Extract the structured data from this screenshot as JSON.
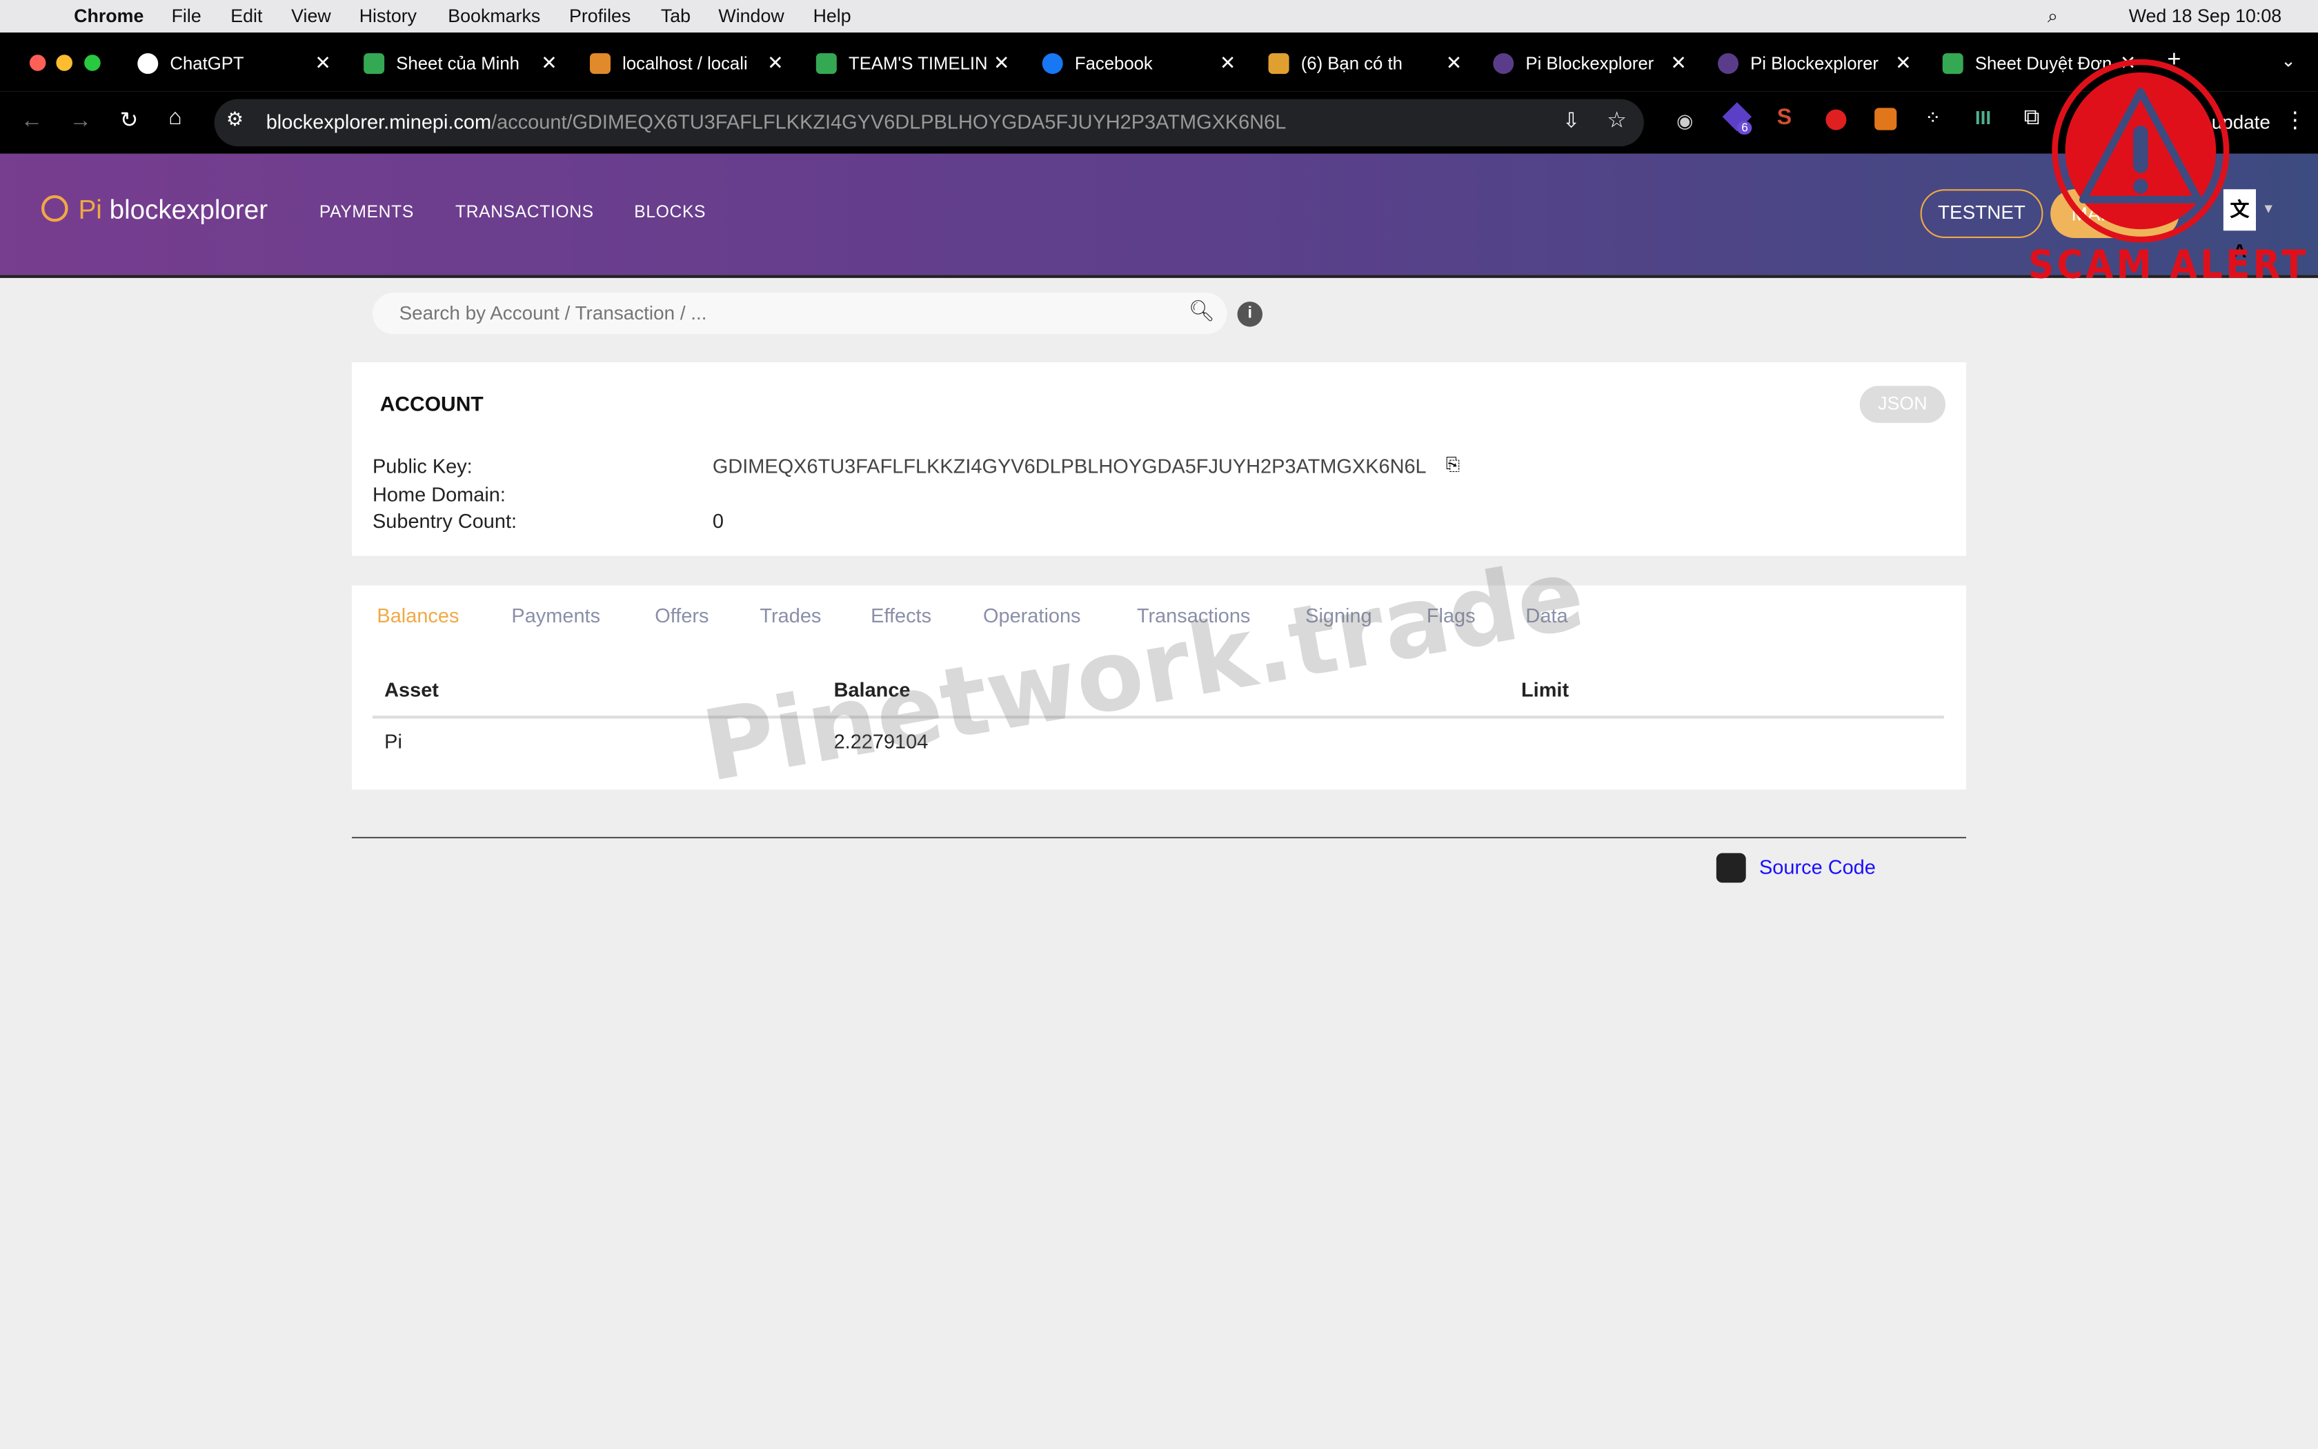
{
  "menubar": {
    "app": "Chrome",
    "items": [
      "File",
      "Edit",
      "View",
      "History",
      "Bookmarks",
      "Profiles",
      "Tab",
      "Window",
      "Help"
    ],
    "clock": "Wed 18 Sep  10:08"
  },
  "tabs": [
    {
      "title": "ChatGPT",
      "color": "#ffffff"
    },
    {
      "title": "Sheet của Minh",
      "color": "#34a853"
    },
    {
      "title": "localhost / locali",
      "color": "#e08a2c"
    },
    {
      "title": "TEAM'S TIMELIN",
      "color": "#34a853"
    },
    {
      "title": "Facebook",
      "color": "#1877f2"
    },
    {
      "title": "(6) Bạn có th",
      "color": "#e0a030"
    },
    {
      "title": "Pi Blockexplorer",
      "color": "#5a3d8a"
    },
    {
      "title": "Pi Blockexplorer",
      "color": "#5a3d8a"
    },
    {
      "title": "Sheet Duyệt Đơn",
      "color": "#34a853"
    }
  ],
  "url": {
    "host": "blockexplorer.minepi.com",
    "path": "/account/GDIMEQX6TU3FAFLFLKKZI4GYV6DLPBLHOYGDA5FJUYH2P3ATMGXK6N6L"
  },
  "toolbar": {
    "update_label": "update",
    "ext_badge": "6"
  },
  "site": {
    "logo_pi": "Pi",
    "logo_name": "blockexplorer",
    "nav": [
      "PAYMENTS",
      "TRANSACTIONS",
      "BLOCKS"
    ],
    "testnet": "TESTNET",
    "mainnet": "MAINNET"
  },
  "overlay": {
    "scam_alert": "SCAM ALERT",
    "watermark": "Pinetwork.trade"
  },
  "search": {
    "placeholder": "Search by Account / Transaction / ..."
  },
  "account": {
    "title": "ACCOUNT",
    "json_button": "JSON",
    "fields": [
      {
        "label": "Public Key:",
        "value": "GDIMEQX6TU3FAFLFLKKZI4GYV6DLPBLHOYGDA5FJUYH2P3ATMGXK6N6L"
      },
      {
        "label": "Home Domain:",
        "value": ""
      },
      {
        "label": "Subentry Count:",
        "value": "0"
      }
    ]
  },
  "details": {
    "tabs": [
      "Balances",
      "Payments",
      "Offers",
      "Trades",
      "Effects",
      "Operations",
      "Transactions",
      "Signing",
      "Flags",
      "Data"
    ],
    "active_tab": "Balances",
    "columns": [
      "Asset",
      "Balance",
      "Limit"
    ],
    "rows": [
      {
        "asset": "Pi",
        "balance": "2.2279104",
        "limit": ""
      }
    ]
  },
  "footer": {
    "source_code": "Source Code"
  },
  "colors": {
    "accent": "#f0a945",
    "link": "#1a0dff",
    "alert": "#e0101b"
  }
}
